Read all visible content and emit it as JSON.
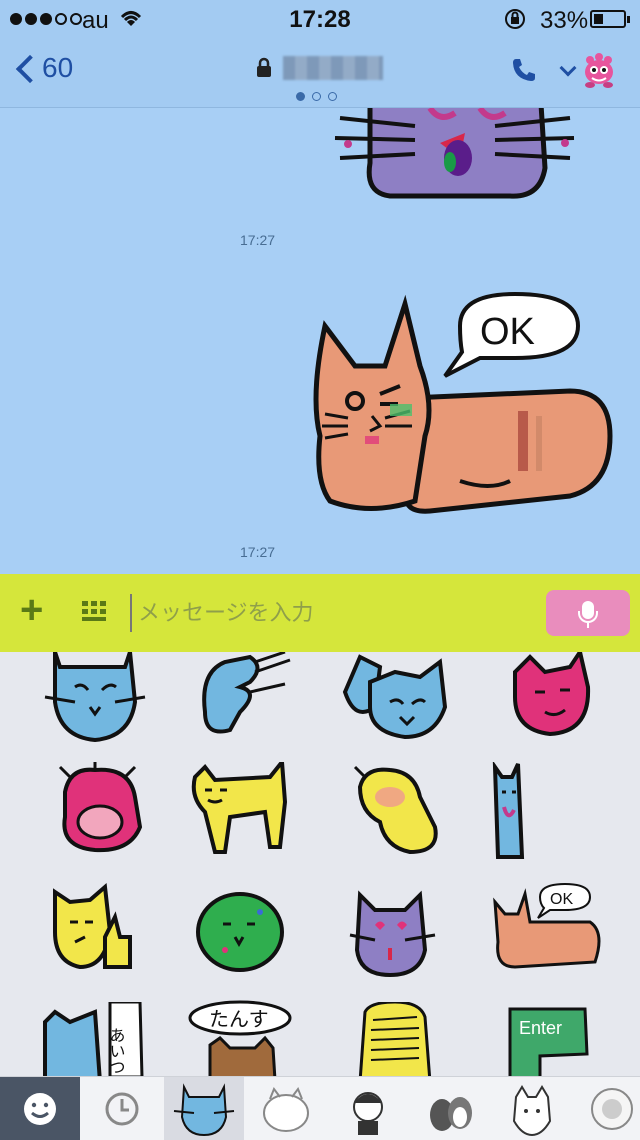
{
  "status_bar": {
    "carrier": "au",
    "time": "17:28",
    "battery_percent": "33%",
    "battery_level": 0.33,
    "signal_bars_filled": 3,
    "signal_bars_total": 5
  },
  "header": {
    "back_label": "60",
    "page_indicator_count": 3,
    "active_page": 0
  },
  "chat": {
    "messages": [
      {
        "type": "sticker",
        "sticker": "purple-cat-sticker",
        "time": "17:27"
      },
      {
        "type": "sticker",
        "sticker": "orange-cat-ok-sticker",
        "time": "17:27",
        "speech_text": "OK"
      }
    ]
  },
  "input_bar": {
    "placeholder": "メッセージを入力"
  },
  "sticker_grid": {
    "labels": {
      "ok_text": "OK",
      "aitsu_text": "あいつ",
      "tansu_text": "たんす",
      "enter_text": "Enter"
    }
  },
  "colors": {
    "chat_background": "#a8cff5",
    "input_bar": "#d5e63b",
    "mic_button": "#e98dbd",
    "accent": "#1f4fa3"
  }
}
